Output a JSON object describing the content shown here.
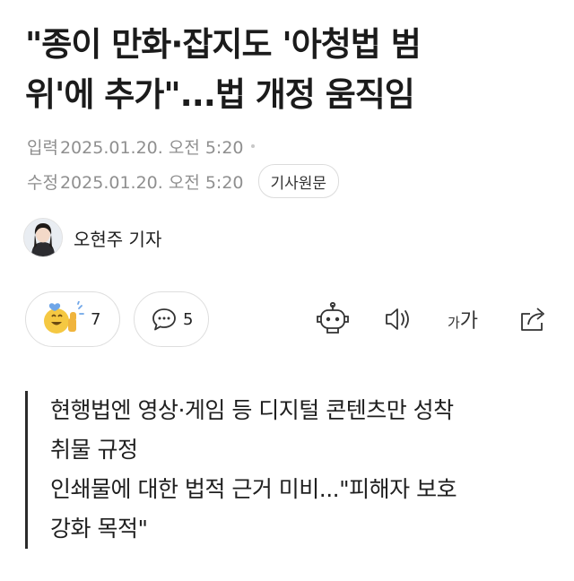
{
  "article": {
    "headline_line1": "\"종이 만화·잡지도 '아청법 범",
    "headline_line2": "위'에 추가\"...법 개정 움직임",
    "published_label": "입력",
    "published_time": "2025.01.20. 오전 5:20",
    "modified_label": "수정",
    "modified_time": "2025.01.20. 오전 5:20",
    "source_button": "기사원문",
    "reporter": "오현주 기자"
  },
  "actions": {
    "reaction_count": "7",
    "comment_count": "5",
    "font_small": "가",
    "font_large": "가",
    "icons": [
      "reaction-emoji-icon",
      "comment-icon",
      "summary-bot-icon",
      "speaker-icon",
      "font-size-icon",
      "share-icon"
    ]
  },
  "summary": {
    "lines": [
      "현행법엔 영상·게임 등 디지털 콘텐츠만 성착",
      "취물 규정",
      "인쇄물에 대한 법적 근거 미비...\"피해자 보호",
      "강화 목적\""
    ]
  },
  "colors": {
    "text": "#1b1b1b",
    "meta": "#8f8f8f",
    "border": "#dedede",
    "emoji": "#f5c842"
  }
}
